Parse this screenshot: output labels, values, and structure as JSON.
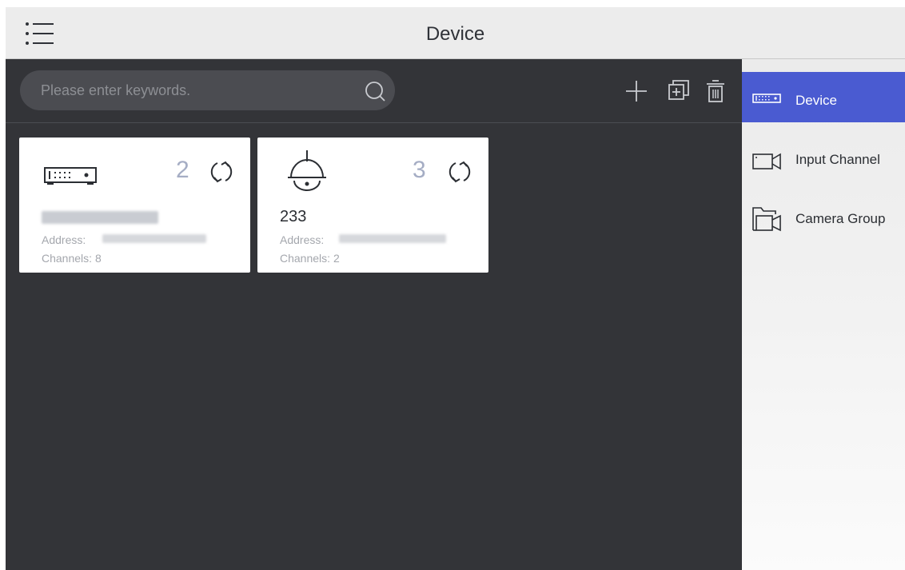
{
  "header": {
    "title": "Device"
  },
  "search": {
    "placeholder": "Please enter keywords."
  },
  "toolbar": {
    "add_icon": "plus-icon",
    "copy_icon": "add-box-icon",
    "delete_icon": "trash-icon"
  },
  "devices": [
    {
      "icon": "nvr-icon",
      "count": "2",
      "address_label": "Address:",
      "channels_label": "Channels:",
      "channels": "8"
    },
    {
      "icon": "dome-camera-icon",
      "count": "3",
      "name": "233",
      "address_label": "Address:",
      "channels_label": "Channels:",
      "channels": "2"
    }
  ],
  "sidebar": {
    "items": [
      {
        "label": "Device",
        "icon": "device-icon",
        "active": true
      },
      {
        "label": "Input Channel",
        "icon": "video-camera-icon",
        "active": false
      },
      {
        "label": "Camera Group",
        "icon": "camera-group-icon",
        "active": false
      }
    ]
  },
  "colors": {
    "accent": "#4a5bd1",
    "main_bg": "#333438",
    "topbar_bg": "#ececec",
    "count_text": "#a5adc4"
  }
}
